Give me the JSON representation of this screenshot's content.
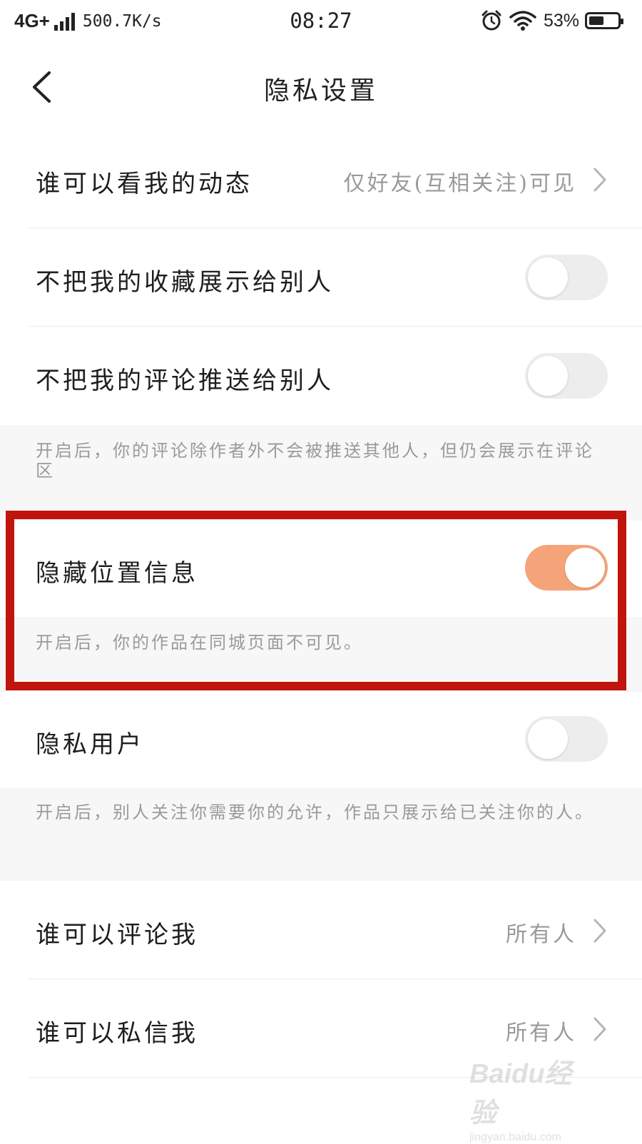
{
  "status_bar": {
    "network": "4G+",
    "speed": "500.7K/s",
    "time": "08:27",
    "battery_percent": "53%",
    "battery_level": 0.53
  },
  "nav": {
    "title": "隐私设置"
  },
  "rows": {
    "moments": {
      "label": "谁可以看我的动态",
      "value": "仅好友(互相关注)可见"
    },
    "favorites": {
      "label": "不把我的收藏展示给别人",
      "toggle": "off"
    },
    "comments_push": {
      "label": "不把我的评论推送给别人",
      "toggle": "off",
      "note": "开启后，你的评论除作者外不会被推送其他人，但仍会展示在评论区"
    },
    "hide_location": {
      "label": "隐藏位置信息",
      "toggle": "on",
      "note": "开启后，你的作品在同城页面不可见。"
    },
    "private_user": {
      "label": "隐私用户",
      "toggle": "off",
      "note": "开启后，别人关注你需要你的允许，作品只展示给已关注你的人。"
    },
    "who_comment": {
      "label": "谁可以评论我",
      "value": "所有人"
    },
    "who_message": {
      "label": "谁可以私信我",
      "value": "所有人"
    }
  },
  "watermark": {
    "brand": "Baidu经验",
    "url": "jingyan.baidu.com"
  },
  "colors": {
    "accent_toggle": "#f5a47a",
    "highlight_box": "#c0140c",
    "note_bg": "#f7f7f7"
  }
}
